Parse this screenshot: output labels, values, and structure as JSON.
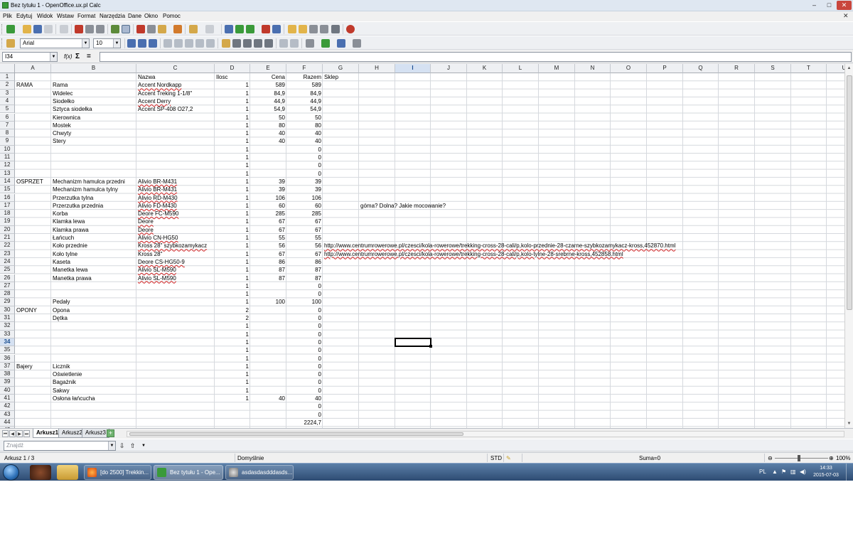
{
  "window": {
    "title": "Bez tytułu 1 - OpenOffice.ux.pl Calc",
    "min_glyph": "‒",
    "max_glyph": "□",
    "close_glyph": "✕",
    "doc_close_glyph": "✕"
  },
  "menu": [
    "Plik",
    "Edytuj",
    "Widok",
    "Wstaw",
    "Format",
    "Narzędzia",
    "Dane",
    "Okno",
    "Pomoc"
  ],
  "format_toolbar": {
    "font_name": "Arial",
    "font_size": "10"
  },
  "formula_bar": {
    "cell_ref": "I34",
    "fx_label": "f(x)",
    "sum_label": "Σ",
    "equals_label": "=",
    "content": ""
  },
  "columns": [
    "A",
    "B",
    "C",
    "D",
    "E",
    "F",
    "G",
    "H",
    "I",
    "J",
    "K",
    "L",
    "M",
    "N",
    "O",
    "P",
    "Q",
    "R",
    "S",
    "T",
    "U"
  ],
  "selected_column": "I",
  "selected_row": 34,
  "rows": [
    {
      "n": 1,
      "c": "Nazwa",
      "d": "Ilosc",
      "e": "Cena",
      "f": "Razem",
      "g": "Sklep"
    },
    {
      "n": 2,
      "a": "RAMA",
      "b": "Rama",
      "c": "Accent Nordkapp",
      "d": "1",
      "e": "589",
      "f": "589"
    },
    {
      "n": 3,
      "b": "Widelec",
      "c": "Accent Treking 1-1/8\"",
      "d": "1",
      "e": "84,9",
      "f": "84,9"
    },
    {
      "n": 4,
      "b": "Siodełko",
      "c": "Accent Derry",
      "d": "1",
      "e": "44,9",
      "f": "44,9"
    },
    {
      "n": 5,
      "b": "Sztyca siodełka",
      "c": "Accent SP-408 O27,2",
      "d": "1",
      "e": "54,9",
      "f": "54,9"
    },
    {
      "n": 6,
      "b": "Kierownica",
      "d": "1",
      "e": "50",
      "f": "50"
    },
    {
      "n": 7,
      "b": "Mostek",
      "d": "1",
      "e": "80",
      "f": "80"
    },
    {
      "n": 8,
      "b": "Chwyty",
      "d": "1",
      "e": "40",
      "f": "40"
    },
    {
      "n": 9,
      "b": "Stery",
      "d": "1",
      "e": "40",
      "f": "40"
    },
    {
      "n": 10,
      "d": "1",
      "f": "0"
    },
    {
      "n": 11,
      "d": "1",
      "f": "0"
    },
    {
      "n": 12,
      "d": "1",
      "f": "0"
    },
    {
      "n": 13,
      "d": "1",
      "f": "0"
    },
    {
      "n": 14,
      "a": "OSPRZET",
      "b": "Mechanizm hamulca przedni",
      "c": "Alivio BR-M431",
      "d": "1",
      "e": "39",
      "f": "39"
    },
    {
      "n": 15,
      "b": "Mechanizm hamulca tylny",
      "c": "Alivio BR-M431",
      "d": "1",
      "e": "39",
      "f": "39"
    },
    {
      "n": 16,
      "b": "Przerzutka tylna",
      "c": "Alivio RD-M430",
      "d": "1",
      "e": "106",
      "f": "106"
    },
    {
      "n": 17,
      "b": "Przerzutka przednia",
      "c": "Alivio FD-M430",
      "d": "1",
      "e": "60",
      "f": "60",
      "h": "góma? Dolna? Jakie mocowanie?"
    },
    {
      "n": 18,
      "b": "Korba",
      "c": "Deore FC-M590",
      "d": "1",
      "e": "285",
      "f": "285"
    },
    {
      "n": 19,
      "b": "Klamka lewa",
      "c": "Deore",
      "d": "1",
      "e": "67",
      "f": "67"
    },
    {
      "n": 20,
      "b": "Klamka prawa",
      "c": "Deore",
      "d": "1",
      "e": "67",
      "f": "67"
    },
    {
      "n": 21,
      "b": "Łańcuch",
      "c": "Alivio CN-HG50",
      "d": "1",
      "e": "55",
      "f": "55"
    },
    {
      "n": 22,
      "b": "Koło przednie",
      "c": "Kross 28\" szybkozamykacz",
      "d": "1",
      "e": "56",
      "f": "56",
      "g": "http://www.centrumrowerowe.pl/czesci/kola-rowerowe/trekking-cross-28-cali/p,kolo-przednie-28-czarne-szybkozamykacz-kross,452870.html"
    },
    {
      "n": 23,
      "b": "Koło tylne",
      "c": "Kross 28\"",
      "d": "1",
      "e": "67",
      "f": "67",
      "g": "http://www.centrumrowerowe.pl/czesci/kola-rowerowe/trekking-cross-28-cali/p,kolo-tylne-28-srebrne-kross,452858.html"
    },
    {
      "n": 24,
      "b": "Kaseta",
      "c": "Deore CS-HG50-9",
      "d": "1",
      "e": "86",
      "f": "86"
    },
    {
      "n": 25,
      "b": "Manetka lewa",
      "c": "Alivio SL-M590",
      "d": "1",
      "e": "87",
      "f": "87"
    },
    {
      "n": 26,
      "b": "Manetka prawa",
      "c": "Alivio SL-M590",
      "d": "1",
      "e": "87",
      "f": "87"
    },
    {
      "n": 27,
      "d": "1",
      "f": "0"
    },
    {
      "n": 28,
      "d": "1",
      "f": "0"
    },
    {
      "n": 29,
      "b": "Pedały",
      "d": "1",
      "e": "100",
      "f": "100"
    },
    {
      "n": 30,
      "a": "OPONY",
      "b": "Opona",
      "d": "2",
      "f": "0"
    },
    {
      "n": 31,
      "b": "Dętka",
      "d": "2",
      "f": "0"
    },
    {
      "n": 32,
      "d": "1",
      "f": "0"
    },
    {
      "n": 33,
      "d": "1",
      "f": "0"
    },
    {
      "n": 34,
      "d": "1",
      "f": "0"
    },
    {
      "n": 35,
      "d": "1",
      "f": "0"
    },
    {
      "n": 36,
      "d": "1",
      "f": "0"
    },
    {
      "n": 37,
      "a": "Bajery",
      "b": "Licznik",
      "d": "1",
      "f": "0"
    },
    {
      "n": 38,
      "b": "Oświetlenie",
      "d": "1",
      "f": "0"
    },
    {
      "n": 39,
      "b": "Bagażnik",
      "d": "1",
      "f": "0"
    },
    {
      "n": 40,
      "b": "Sakwy",
      "d": "1",
      "f": "0"
    },
    {
      "n": 41,
      "b": "Osłona łańcucha",
      "d": "1",
      "e": "40",
      "f": "40"
    },
    {
      "n": 42,
      "f": "0"
    },
    {
      "n": 43,
      "f": "0"
    },
    {
      "n": 44,
      "f": "2224,7"
    },
    {
      "n": 45
    }
  ],
  "sheet_tabs": [
    "Arkusz1",
    "Arkusz2",
    "Arkusz3"
  ],
  "active_sheet": "Arkusz1",
  "find": {
    "placeholder": "Znajdź"
  },
  "status": {
    "sheet": "Arkusz 1 / 3",
    "style": "Domyślnie",
    "mode": "STD",
    "sum": "Suma=0",
    "zoom": "100%"
  },
  "taskbar": {
    "items": [
      "[do 2500] Trekkin...",
      "Bez tytułu 1 - Ope...",
      "asdasdasdddasds..."
    ],
    "active_index": 1,
    "lang": "PL",
    "time": "14:33",
    "date": "2015-07-03"
  },
  "colors": {
    "selection": "#d5e1f2",
    "accent": "#1a4d8f",
    "spell_underline": "#d12020"
  }
}
